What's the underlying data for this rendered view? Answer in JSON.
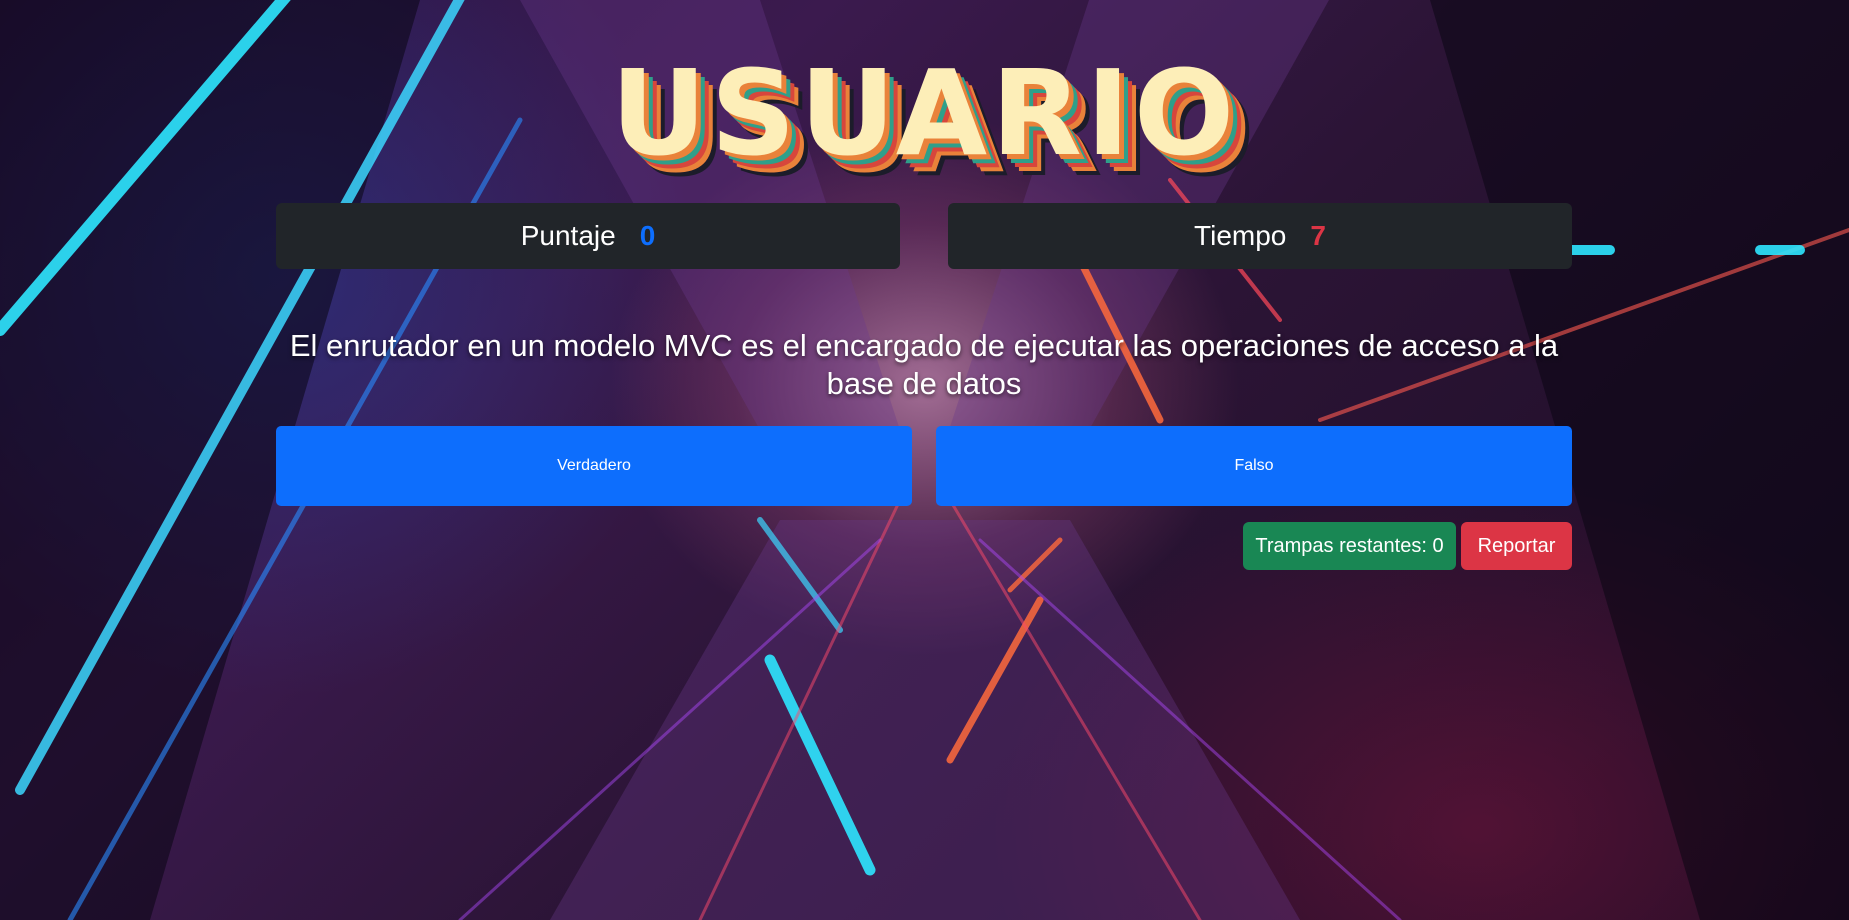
{
  "header": {
    "title": "USUARIO"
  },
  "stats": {
    "score_label": "Puntaje",
    "score_value": "0",
    "time_label": "Tiempo",
    "time_value": "7"
  },
  "question": {
    "text": "El enrutador en un modelo MVC es el encargado de ejecutar las operaciones de acceso a la base de datos"
  },
  "answers": {
    "true_label": "Verdadero",
    "false_label": "Falso"
  },
  "actions": {
    "cheats_label": "Trampas restantes: 0",
    "report_label": "Reportar"
  },
  "colors": {
    "score_accent": "#0d6efd",
    "time_accent": "#dc3545",
    "answer_button": "#0d6efd",
    "cheats_button": "#198754",
    "report_button": "#dc3545",
    "stat_background": "#212529"
  }
}
